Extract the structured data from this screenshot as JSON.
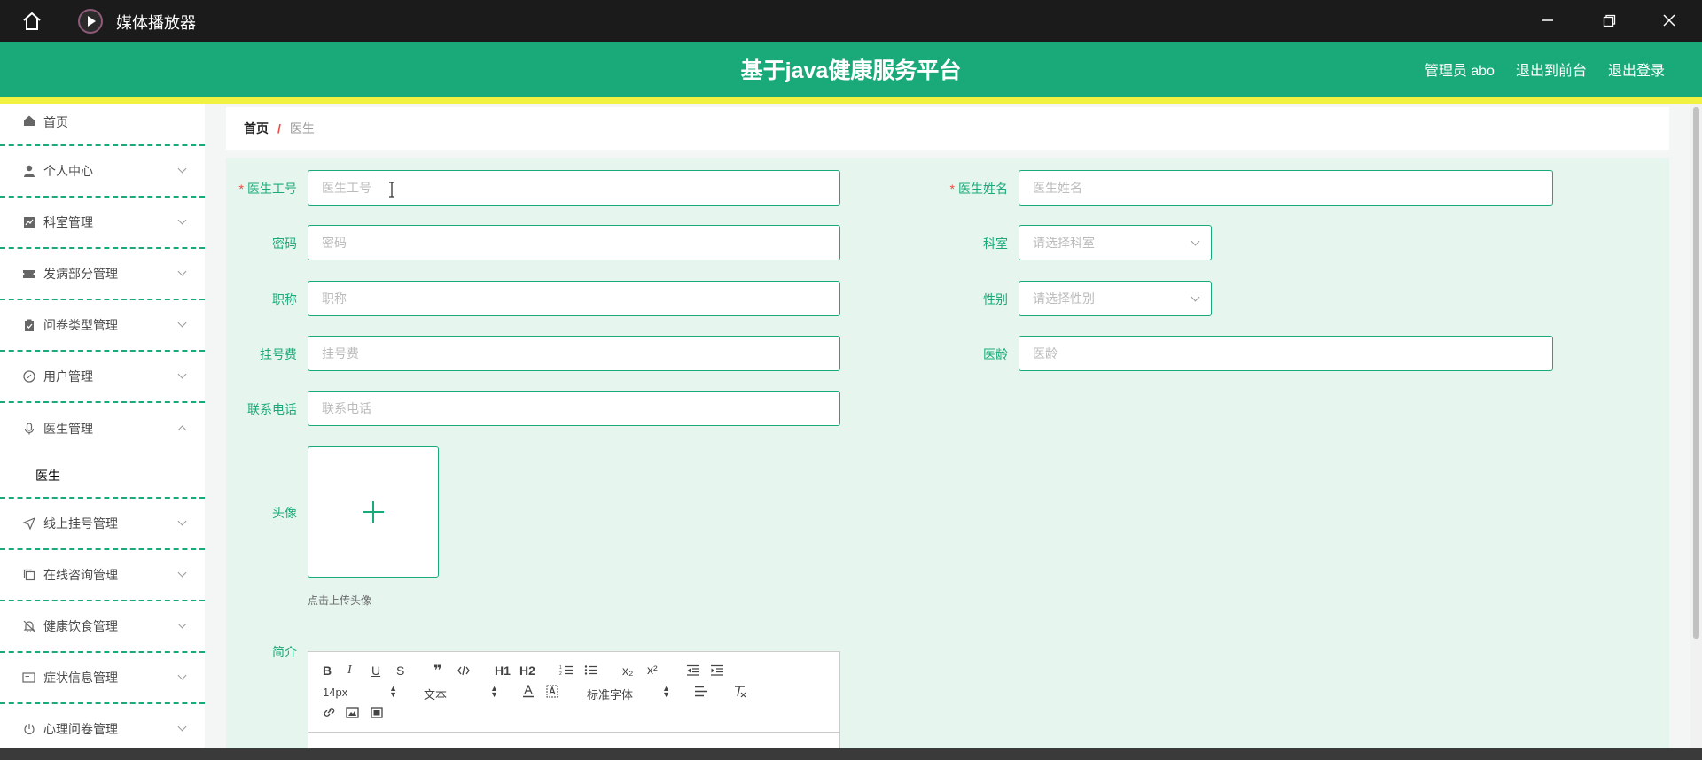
{
  "window": {
    "title": "媒体播放器",
    "icons": [
      "home-icon",
      "media-player-icon",
      "minimize-icon",
      "maximize-icon",
      "close-icon"
    ]
  },
  "header": {
    "title": "基于java健康服务平台",
    "links": [
      "管理员 abo",
      "退出到前台",
      "退出登录"
    ],
    "colors": {
      "primary": "#1aaa79",
      "accent_bar": "#f1f142"
    }
  },
  "sidebar": {
    "items": [
      {
        "label": "首页",
        "icon": "home-icon"
      },
      {
        "label": "个人中心",
        "icon": "user-icon"
      },
      {
        "label": "科室管理",
        "icon": "chart-icon"
      },
      {
        "label": "发病部分管理",
        "icon": "ticket-icon"
      },
      {
        "label": "问卷类型管理",
        "icon": "clipboard-icon"
      },
      {
        "label": "用户管理",
        "icon": "compass-icon"
      },
      {
        "label": "医生管理",
        "icon": "microphone-icon",
        "open": true,
        "children": [
          "医生"
        ]
      },
      {
        "label": "线上挂号管理",
        "icon": "send-icon"
      },
      {
        "label": "在线咨询管理",
        "icon": "copy-icon"
      },
      {
        "label": "健康饮食管理",
        "icon": "bell-off-icon"
      },
      {
        "label": "症状信息管理",
        "icon": "card-icon"
      },
      {
        "label": "心理问卷管理",
        "icon": "power-icon"
      }
    ]
  },
  "breadcrumb": {
    "home": "首页",
    "separator": "/",
    "current": "医生"
  },
  "form": {
    "doctor_no": {
      "label": "医生工号",
      "placeholder": "医生工号",
      "required": true
    },
    "doctor_name": {
      "label": "医生姓名",
      "placeholder": "医生姓名",
      "required": true
    },
    "password": {
      "label": "密码",
      "placeholder": "密码"
    },
    "department": {
      "label": "科室",
      "placeholder": "请选择科室"
    },
    "title": {
      "label": "职称",
      "placeholder": "职称"
    },
    "gender": {
      "label": "性别",
      "placeholder": "请选择性别"
    },
    "fee": {
      "label": "挂号费",
      "placeholder": "挂号费"
    },
    "seniority": {
      "label": "医龄",
      "placeholder": "医龄"
    },
    "phone": {
      "label": "联系电话",
      "placeholder": "联系电话"
    },
    "avatar": {
      "label": "头像",
      "tip": "点击上传头像"
    },
    "intro": {
      "label": "简介"
    }
  },
  "editor": {
    "row1": [
      "B",
      "I",
      "U",
      "S",
      "quote-icon",
      "code-icon",
      "H1",
      "H2",
      "ordered-list-icon",
      "bullet-list-icon",
      "x₂",
      "x²",
      "outdent-icon",
      "indent-icon"
    ],
    "size": "14px",
    "format": "文本",
    "font": "标准字体",
    "row2_icons": [
      "font-color-icon",
      "background-color-icon",
      "align-icon",
      "clear-format-icon"
    ],
    "row3_icons": [
      "link-icon",
      "image-icon",
      "video-icon"
    ]
  }
}
